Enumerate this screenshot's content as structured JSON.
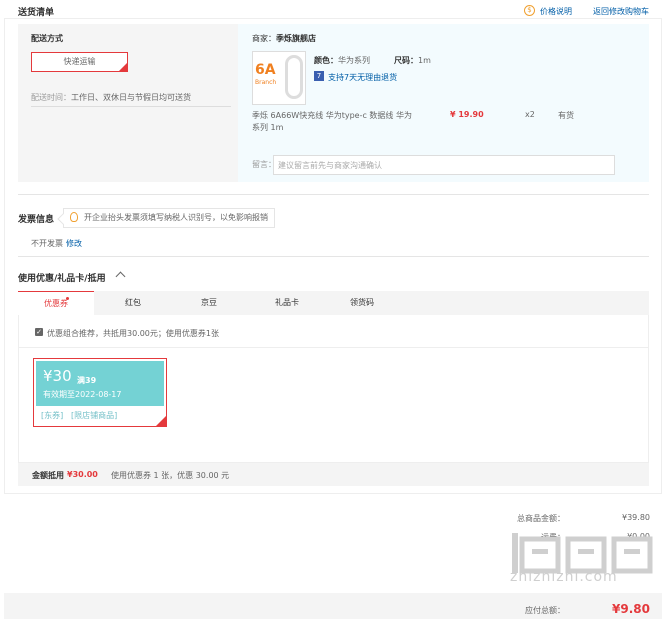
{
  "section_title": "送货清单",
  "links": {
    "price_info": "价格说明",
    "back_to_cart": "返回修改购物车"
  },
  "delivery": {
    "label": "配送方式",
    "method": "快递运输",
    "time_label": "配送时间：",
    "time_value": "工作日、双休日与节假日均可送货"
  },
  "shop": {
    "label": "商家：",
    "name": "季烁旗舰店"
  },
  "product": {
    "image_text": "6A",
    "image_subtext": "Branch",
    "color_label": "颜色：",
    "color_value": "华为系列",
    "size_label": "尺码：",
    "size_value": "1m",
    "return_badge": "7",
    "return_text": "支持7天无理由退货",
    "title": "季烁 6A66W快充线 华为type-c 数据线 华为系列 1m",
    "price": "¥ 19.90",
    "qty": "x2",
    "stock": "有货"
  },
  "remark": {
    "label": "留言：",
    "placeholder": "建议留言前先与商家沟通确认"
  },
  "invoice": {
    "title": "发票信息",
    "tip": "开企业抬头发票须填写纳税人识别号，以免影响报销",
    "status": "不开发票",
    "modify": "修改"
  },
  "coupons": {
    "title": "使用优惠/礼品卡/抵用",
    "tabs": [
      "优惠券",
      "红包",
      "京豆",
      "礼品卡",
      "领货码"
    ],
    "recommend": "优惠组合推荐，共抵用30.00元；使用优惠券1张",
    "card": {
      "amount": "¥30",
      "condition": "满39",
      "validity": "有效期至2022-08-17",
      "tag1": "[东券]",
      "tag2": "[限店铺商品]"
    },
    "total_label": "金额抵用",
    "total_value": "¥30.00",
    "total_desc": "使用优惠券 1 张，优惠 30.00 元"
  },
  "summary": {
    "goods_label": "总商品金额：",
    "goods_value": "¥39.80",
    "freight_label": "运费：",
    "freight_value": "¥0.00",
    "payable_label": "应付总额：",
    "payable_value": "¥9.80"
  },
  "watermark": {
    "text": "zhizhizhi.com"
  },
  "colors": {
    "accent": "#e4393c",
    "link": "#005ea7",
    "coupon": "#74d2d4"
  }
}
